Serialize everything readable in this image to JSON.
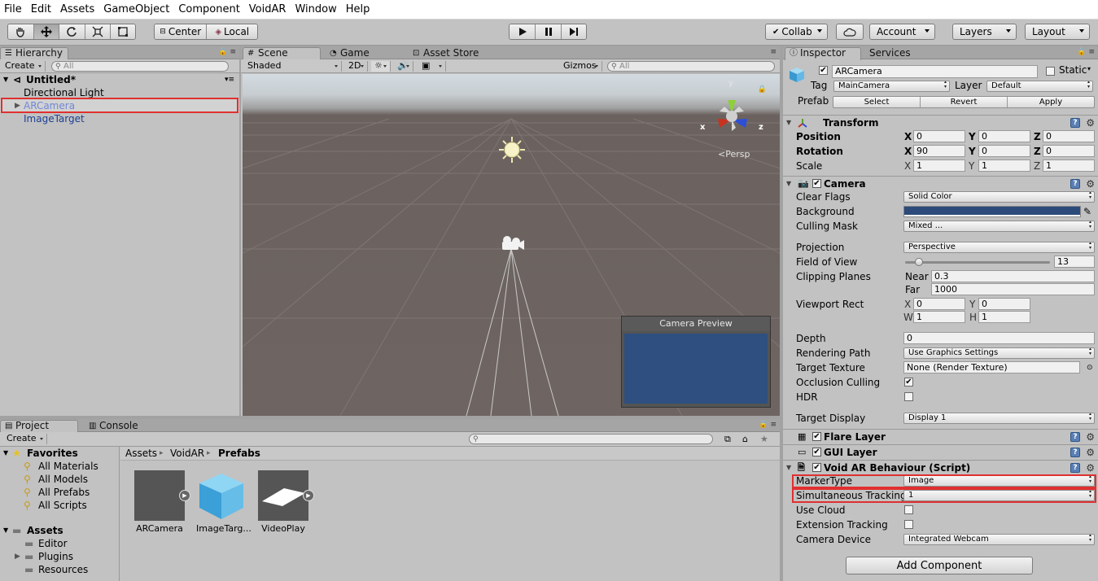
{
  "menu": [
    "File",
    "Edit",
    "Assets",
    "GameObject",
    "Component",
    "VoidAR",
    "Window",
    "Help"
  ],
  "toolbar": {
    "pivot": "Center",
    "space": "Local",
    "collab": "Collab",
    "account": "Account",
    "layers": "Layers",
    "layout": "Layout"
  },
  "hierarchy": {
    "tab": "Hierarchy",
    "create": "Create",
    "search_placeholder": "All",
    "scene": "Untitled*",
    "items": [
      "Directional Light",
      "ARCamera",
      "ImageTarget"
    ]
  },
  "scene": {
    "tabs": [
      "Scene",
      "Game",
      "Asset Store"
    ],
    "shading": "Shaded",
    "mode2d": "2D",
    "gizmos": "Gizmos",
    "search_placeholder": "All",
    "persp": "Persp",
    "axis_x": "x",
    "axis_y": "y",
    "axis_z": "z",
    "preview_title": "Camera Preview"
  },
  "project": {
    "tabs": [
      "Project",
      "Console"
    ],
    "create": "Create",
    "favorites_title": "Favorites",
    "favorites": [
      "All Materials",
      "All Models",
      "All Prefabs",
      "All Scripts"
    ],
    "assets_title": "Assets",
    "assets": [
      "Editor",
      "Plugins",
      "Resources"
    ],
    "breadcrumb": [
      "Assets",
      "VoidAR",
      "Prefabs"
    ],
    "prefabs": [
      "ARCamera",
      "ImageTarg...",
      "VideoPlay"
    ]
  },
  "inspector": {
    "tabs": [
      "Inspector",
      "Services"
    ],
    "object_name": "ARCamera",
    "static_label": "Static",
    "tag_label": "Tag",
    "tag": "MainCamera",
    "layer_label": "Layer",
    "layer": "Default",
    "prefab_label": "Prefab",
    "prefab_buttons": [
      "Select",
      "Revert",
      "Apply"
    ],
    "transform": {
      "title": "Transform",
      "position_label": "Position",
      "rotation_label": "Rotation",
      "scale_label": "Scale",
      "position": [
        "0",
        "0",
        "0"
      ],
      "rotation": [
        "90",
        "0",
        "0"
      ],
      "scale": [
        "1",
        "1",
        "1"
      ]
    },
    "camera": {
      "title": "Camera",
      "clear_flags_label": "Clear Flags",
      "clear_flags": "Solid Color",
      "background_label": "Background",
      "background_color": "#2d4b7a",
      "culling_mask_label": "Culling Mask",
      "culling_mask": "Mixed ...",
      "projection_label": "Projection",
      "projection": "Perspective",
      "fov_label": "Field of View",
      "fov": "13",
      "fov_fraction": 0.07,
      "clipping_label": "Clipping Planes",
      "near_label": "Near",
      "near": "0.3",
      "far_label": "Far",
      "far": "1000",
      "viewport_label": "Viewport Rect",
      "viewport": {
        "x": "0",
        "y": "0",
        "w": "1",
        "h": "1"
      },
      "depth_label": "Depth",
      "depth": "0",
      "rendering_path_label": "Rendering Path",
      "rendering_path": "Use Graphics Settings",
      "target_texture_label": "Target Texture",
      "target_texture": "None (Render Texture)",
      "occlusion_label": "Occlusion Culling",
      "hdr_label": "HDR",
      "target_display_label": "Target Display",
      "target_display": "Display 1"
    },
    "flare_layer": "Flare Layer",
    "gui_layer": "GUI Layer",
    "voidar": {
      "title": "Void AR Behaviour (Script)",
      "marker_type_label": "MarkerType",
      "marker_type": "Image",
      "sim_tracking_label": "Simultaneous Tracking",
      "sim_tracking": "1",
      "use_cloud_label": "Use Cloud",
      "extension_label": "Extension Tracking",
      "camera_device_label": "Camera Device",
      "camera_device": "Integrated Webcam"
    },
    "add_component": "Add Component"
  }
}
